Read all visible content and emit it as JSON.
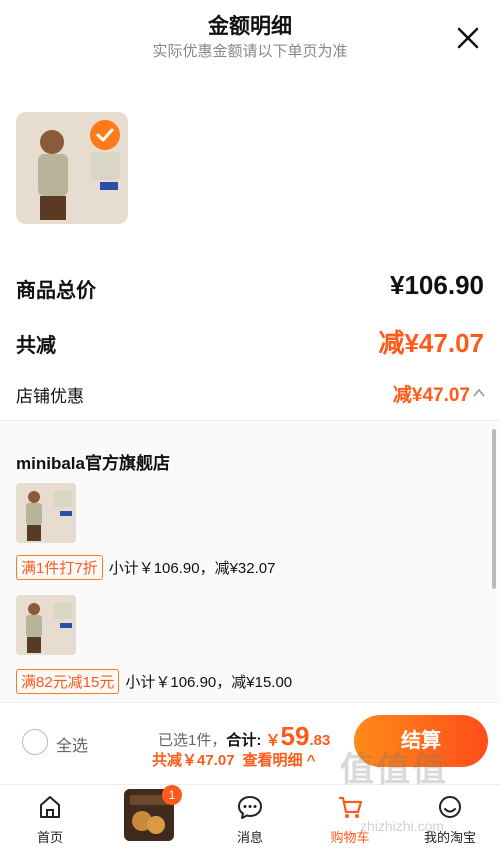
{
  "header": {
    "title": "金额明细",
    "subtitle": "实际优惠金额请以下单页为准",
    "close_icon": "close-icon"
  },
  "summary": {
    "total_label": "商品总价",
    "total_value": "¥106.90",
    "reduce_label": "共减",
    "reduce_value": "减¥47.07",
    "shop_discount_label": "店铺优惠",
    "shop_discount_value": "减¥47.07"
  },
  "shop": {
    "name": "minibala官方旗舰店",
    "promos": [
      {
        "tag": "满1件打7折",
        "text": "小计￥106.90，减¥32.07"
      },
      {
        "tag": "满82元减15元",
        "text": "小计￥106.90，减¥15.00"
      }
    ]
  },
  "bottom": {
    "select_all_label": "全选",
    "selected_prefix": "已选1件，",
    "total_label": "合计:",
    "currency": "￥",
    "total_big": "59",
    "total_small": ".83",
    "reduce_text": "共减￥47.07",
    "detail_link": "查看明细 ^",
    "checkout_label": "结算"
  },
  "tabbar": {
    "tabs": [
      {
        "label": "首页",
        "icon": "home-icon"
      },
      {
        "label": "",
        "icon": "promo-image"
      },
      {
        "label": "消息",
        "icon": "message-icon"
      },
      {
        "label": "购物车",
        "icon": "cart-icon"
      },
      {
        "label": "我的淘宝",
        "icon": "user-icon"
      }
    ],
    "promo_badge": "1"
  },
  "watermark": {
    "text": "值值值",
    "url": "zhizhizhi.com"
  },
  "colors": {
    "accent": "#ff5a1a",
    "accent_gradient_start": "#ff8a1a"
  }
}
